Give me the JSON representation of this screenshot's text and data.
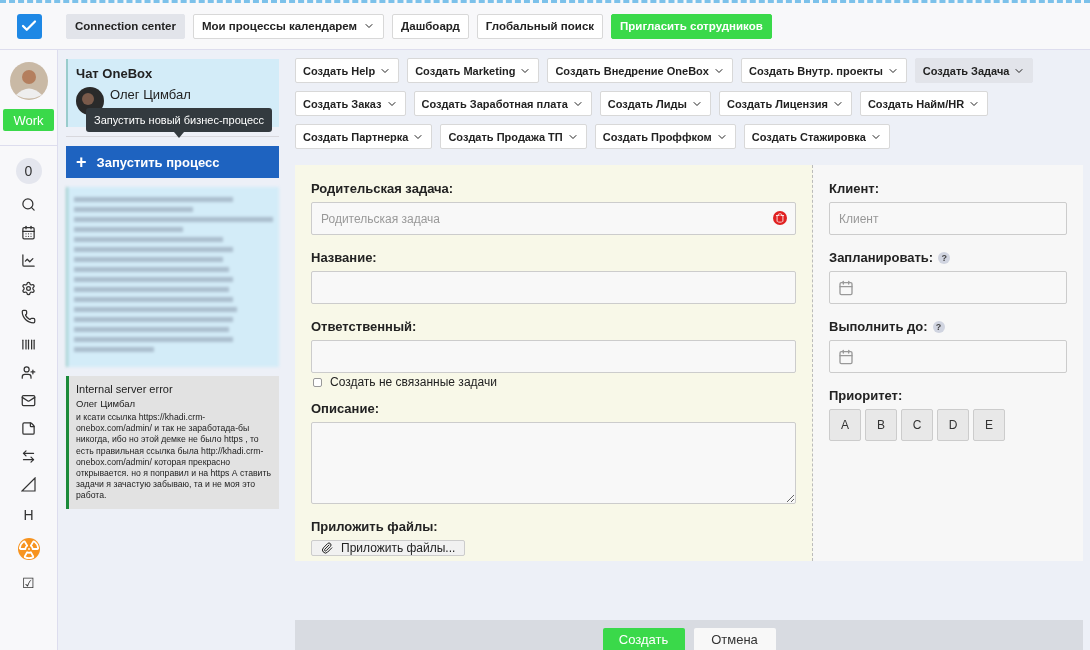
{
  "top_nav": [
    {
      "label": "Connection center",
      "kind": "tab",
      "selected": true
    },
    {
      "label": "Мои процессы календарем",
      "kind": "dropdown",
      "selected": false
    },
    {
      "label": "Дашбоард",
      "kind": "tab",
      "selected": false
    },
    {
      "label": "Глобальный поиск",
      "kind": "tab",
      "selected": false
    },
    {
      "label": "Пригласить сотрудников",
      "kind": "accent",
      "selected": false
    }
  ],
  "user": {
    "status_button": "Work"
  },
  "rail": {
    "counter": "0",
    "letter": "H",
    "last": "☑"
  },
  "chat": {
    "title": "Чат OneBox",
    "author": "Олег Цимбал"
  },
  "tooltip": "Запустить новый бизнес-процесс",
  "launch_button": {
    "icon": "+",
    "label": "Запустить процесс"
  },
  "messages": [
    {
      "kind": "blurred"
    },
    {
      "kind": "message",
      "title": "Internal server error",
      "author": "Олег Цимбал",
      "text": "и ксати ссылка https://khadi.crm-onebox.com/admin/ и так не заработада-бы никогда, ибо но этой демке не было https , то есть правильная ссылка была http://khadi.crm-onebox.com/admin/ которая прекрасно открывается. но я поправил и на https А ставить задачи я зачастую забываю, та и не моя это работа."
    }
  ],
  "create_buttons": [
    {
      "label": "Создать Help",
      "selected": false
    },
    {
      "label": "Создать Marketing",
      "selected": false
    },
    {
      "label": "Создать Внедрение OneBox",
      "selected": false
    },
    {
      "label": "Создать Внутр. проекты",
      "selected": false
    },
    {
      "label": "Создать Задача",
      "selected": true
    },
    {
      "label": "Создать Заказ",
      "selected": false
    },
    {
      "label": "Создать Заработная плата",
      "selected": false
    },
    {
      "label": "Создать Лиды",
      "selected": false
    },
    {
      "label": "Создать Лицензия",
      "selected": false
    },
    {
      "label": "Создать Найм/HR",
      "selected": false
    },
    {
      "label": "Создать Партнерка",
      "selected": false
    },
    {
      "label": "Создать Продажа ТП",
      "selected": false
    },
    {
      "label": "Создать Проффком",
      "selected": false
    },
    {
      "label": "Создать Стажировка",
      "selected": false
    }
  ],
  "form": {
    "parent_task": {
      "label": "Родительская задача:",
      "placeholder": "Родительская задача"
    },
    "name": {
      "label": "Название:"
    },
    "responsible": {
      "label": "Ответственный:"
    },
    "unlinked": {
      "label": "Создать не связанные задачи",
      "checked": false
    },
    "description": {
      "label": "Описание:"
    },
    "attach": {
      "label": "Приложить файлы:",
      "button": "Приложить файлы..."
    },
    "client": {
      "label": "Клиент:",
      "placeholder": "Клиент"
    },
    "schedule": {
      "label": "Запланировать:",
      "help": "?"
    },
    "deadline": {
      "label": "Выполнить до:",
      "help": "?"
    },
    "priority": {
      "label": "Приоритет:",
      "options": [
        {
          "label": "A",
          "selected": false
        },
        {
          "label": "B",
          "selected": false
        },
        {
          "label": "C",
          "selected": false
        },
        {
          "label": "D",
          "selected": false
        },
        {
          "label": "E",
          "selected": false
        }
      ]
    }
  },
  "footer": {
    "submit": "Создать",
    "cancel": "Отмена"
  }
}
